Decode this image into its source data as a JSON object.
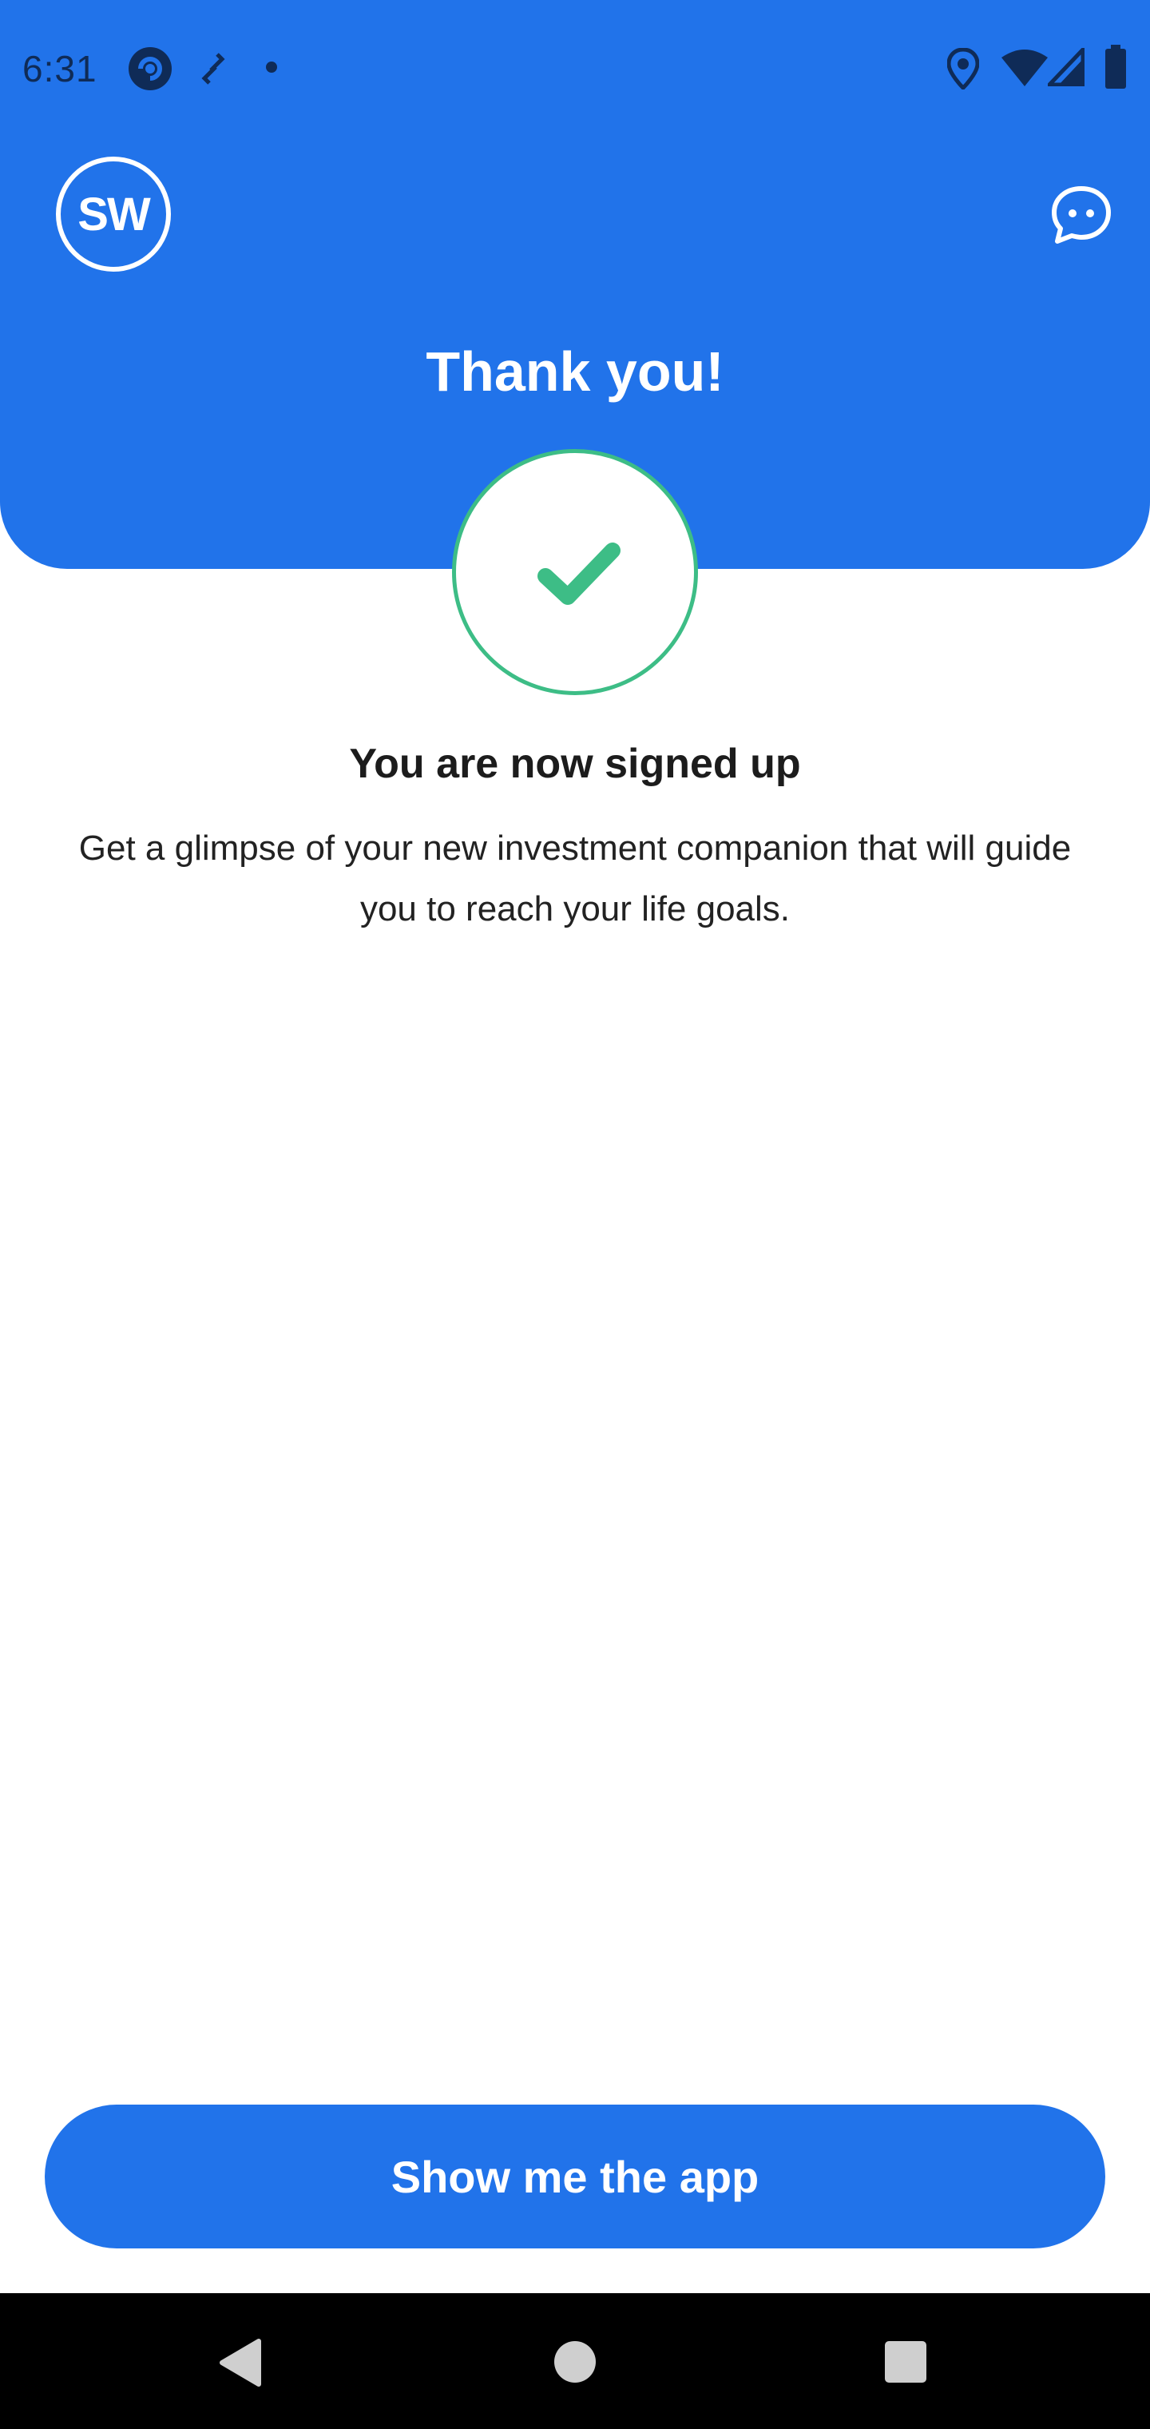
{
  "status_bar": {
    "time": "6:31",
    "icons": [
      "app-notification-icon",
      "sync-icon",
      "dot-icon",
      "location-icon",
      "wifi-icon",
      "signal-icon",
      "battery-icon"
    ]
  },
  "header": {
    "logo_text": "SW",
    "title": "Thank you!",
    "chat_icon": "chat-bubble-icon",
    "background_color": "#2173ea"
  },
  "success": {
    "icon": "checkmark-icon",
    "accent_color": "#3dbd86",
    "heading": "You are now signed up",
    "description": "Get a glimpse of your new investment companion that will guide you to reach your life goals."
  },
  "actions": {
    "primary_label": "Show me the app"
  },
  "nav_bar": {
    "icons": [
      "back-icon",
      "home-icon",
      "recents-icon"
    ]
  }
}
